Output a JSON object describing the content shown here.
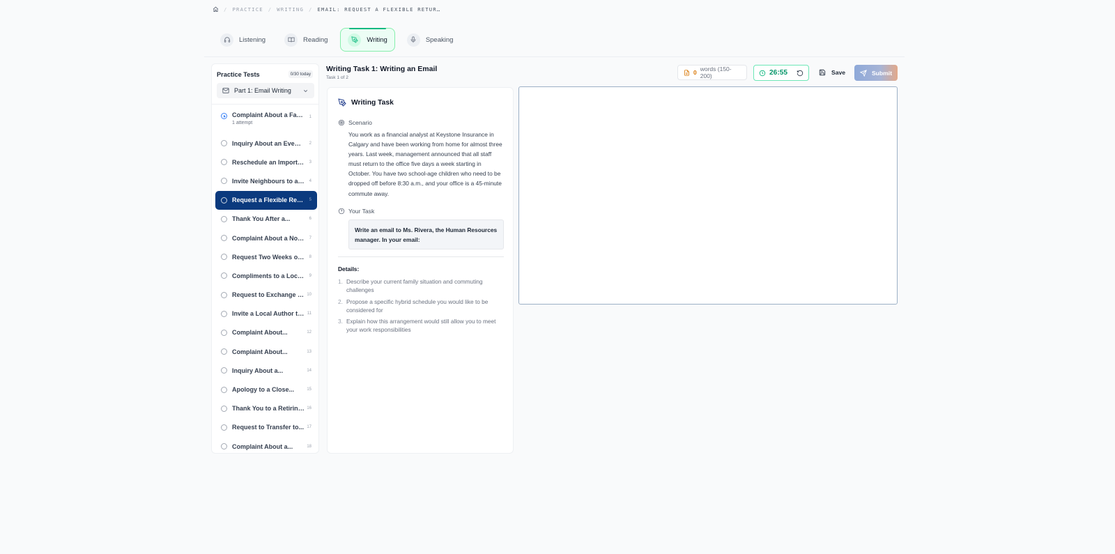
{
  "breadcrumb": {
    "items": [
      "PRACTICE",
      "WRITING"
    ],
    "current": "EMAIL: REQUEST A FLEXIBLE RETUR…"
  },
  "tabs": [
    {
      "label": "Listening",
      "icon": "headphones-icon",
      "active": false
    },
    {
      "label": "Reading",
      "icon": "book-icon",
      "active": false
    },
    {
      "label": "Writing",
      "icon": "pen-icon",
      "active": true
    },
    {
      "label": "Speaking",
      "icon": "microphone-icon",
      "active": false
    }
  ],
  "sidebar": {
    "title": "Practice Tests",
    "count": "0/30 today",
    "part_select": "Part 1: Email Writing",
    "items": [
      {
        "label": "Complaint About a Faulty Product",
        "sub": "1 attempt",
        "num": "1"
      },
      {
        "label": "Inquiry About an Evening Course",
        "num": "2"
      },
      {
        "label": "Reschedule an Important Meeting",
        "num": "3"
      },
      {
        "label": "Invite Neighbours to a Party",
        "num": "4"
      },
      {
        "label": "Request a Flexible Return to Office",
        "num": "5"
      },
      {
        "label": "Thank You After a...",
        "num": "6"
      },
      {
        "label": "Complaint About a Noisy Neighbour",
        "num": "7"
      },
      {
        "label": "Request Two Weeks of...",
        "num": "8"
      },
      {
        "label": "Compliments to a Local...",
        "num": "9"
      },
      {
        "label": "Request to Exchange a Product",
        "num": "10"
      },
      {
        "label": "Invite a Local Author to Speak",
        "num": "11"
      },
      {
        "label": "Complaint About...",
        "num": "12"
      },
      {
        "label": "Complaint About...",
        "num": "13"
      },
      {
        "label": "Inquiry About a...",
        "num": "14"
      },
      {
        "label": "Apology to a Close...",
        "num": "15"
      },
      {
        "label": "Thank You to a Retiring Colleague",
        "num": "16"
      },
      {
        "label": "Request to Transfer to...",
        "num": "17"
      },
      {
        "label": "Complaint About a...",
        "num": "18"
      }
    ]
  },
  "task": {
    "title": "Writing Task 1: Writing an Email",
    "subtitle": "Task 1 of 2"
  },
  "toolbar": {
    "word_count": "0",
    "word_range": "words (150-200)",
    "timer": "26:55",
    "save_label": "Save",
    "submit_label": "Submit"
  },
  "card": {
    "heading": "Writing Task",
    "scenario_label": "Scenario",
    "scenario_text": "You work as a financial analyst at Keystone Insurance in Calgary and have been working from home for almost three years. Last week, management announced that all staff must return to the office five days a week starting in October. You have two school-age children who need to be dropped off before 8:30 a.m., and your office is a 45-minute commute away.",
    "your_task_label": "Your Task",
    "task_text": "Write an email to Ms. Rivera, the Human Resources manager. In your email:",
    "details_label": "Details:",
    "details": [
      {
        "n": "1.",
        "text": "Describe your current family situation and commuting challenges"
      },
      {
        "n": "2.",
        "text": "Propose a specific hybrid schedule you would like to be considered for"
      },
      {
        "n": "3.",
        "text": "Explain how this arrangement would still allow you to meet your work responsibilities"
      }
    ]
  },
  "editor": {
    "value": "",
    "placeholder": ""
  },
  "colors": {
    "active_item": "#0b3a7e",
    "accent_green": "#10b981",
    "warning": "#d97706"
  }
}
